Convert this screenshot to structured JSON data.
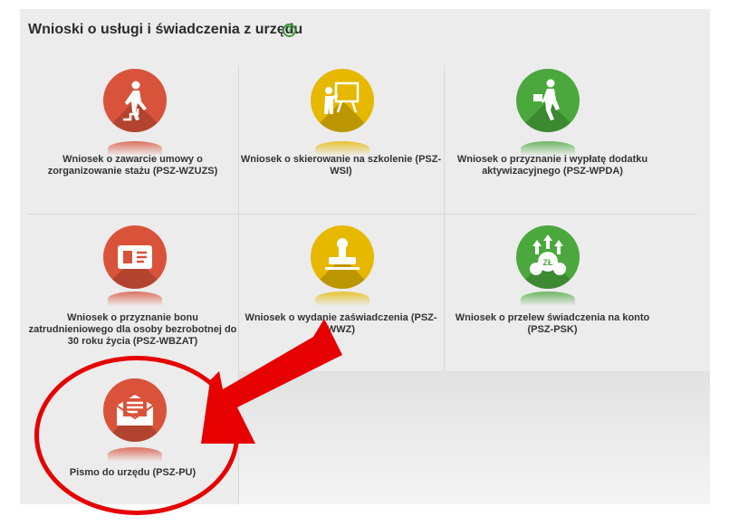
{
  "panel": {
    "title": "Wnioski o usługi i świadczenia z urzędu",
    "help_glyph": "?"
  },
  "tiles": [
    {
      "label": "Wniosek o zawarcie umowy o zorganizowanie stażu (PSZ-WZUZS)",
      "color": "#d9533a",
      "icon": "stairs-walker-icon"
    },
    {
      "label": "Wniosek o skierowanie na szkolenie (PSZ-WSI)",
      "color": "#e6b800",
      "icon": "training-board-icon"
    },
    {
      "label": "Wniosek o przyznanie i wypłatę dodatku aktywizacyjnego (PSZ-WPDA)",
      "color": "#4aa83c",
      "icon": "walking-briefcase-icon"
    },
    {
      "label": "Wniosek o przyznanie bonu zatrudnieniowego dla osoby bezrobotnej do 30 roku życia (PSZ-WBZAT)",
      "color": "#d9533a",
      "icon": "id-card-icon"
    },
    {
      "label": "Wniosek o wydanie zaświadczenia (PSZ-WWZ)",
      "color": "#e6b800",
      "icon": "stamp-icon"
    },
    {
      "label": "Wniosek o przelew świadczenia na konto (PSZ-PSK)",
      "color": "#4aa83c",
      "icon": "money-arrows-icon"
    },
    {
      "label": "Pismo do urzędu (PSZ-PU)",
      "color": "#d9533a",
      "icon": "envelope-letter-icon"
    }
  ],
  "annotation": {
    "arrow_color": "#e60000",
    "highlight_color": "#e60000"
  },
  "icon_text": {
    "currency": "ZŁ"
  }
}
